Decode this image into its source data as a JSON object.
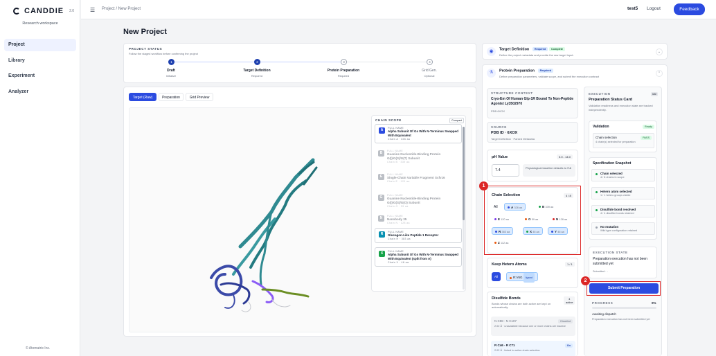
{
  "brand": {
    "name": "CANDDIE",
    "version": "2.0",
    "workspace": "Research workspace",
    "copyright": "© Atomatrix Inc."
  },
  "nav": [
    "Project",
    "Library",
    "Experiment",
    "Analyzer"
  ],
  "topbar": {
    "breadcrumb": "Project / New Project",
    "user": "test5",
    "logout": "Logout",
    "feedback": "Feedback"
  },
  "page_title": "New Project",
  "status": {
    "title": "PROJECT STATUS",
    "subtitle": "Follow the staged workflow before confirming the project",
    "steps": [
      {
        "num": "1",
        "title": "Draft",
        "sub": "Initialize"
      },
      {
        "num": "2",
        "title": "Target Definition",
        "sub": "Required"
      },
      {
        "num": "3",
        "title": "Protein Preparation",
        "sub": "Required"
      },
      {
        "num": "4",
        "title": "Grid Gen.",
        "sub": "Optional"
      }
    ]
  },
  "viewer": {
    "tabs": [
      "Target (Raw)",
      "Preparation",
      "Grid Preview"
    ]
  },
  "chain_scope": {
    "title": "CHAIN SCOPE",
    "compact": "Compact",
    "full_name_label": "FULL NAME",
    "items": [
      {
        "id": "A",
        "name": "Alpha Subunit Of Gs With N-Terminus Swapped With Equivalent",
        "meta": "Chain A · 326 aa",
        "color": "#2b4be0",
        "dim": false
      },
      {
        "id": "B",
        "name": "Guanine Nucleotide-Binding Protein G(I)/G(S)/G(T) Subunit",
        "meta": "Chain B · 339 aa",
        "color": "#6b7280",
        "dim": true
      },
      {
        "id": "E",
        "name": "Single-Chain Variable Fragment Scfv16",
        "meta": "Chain E · 120 aa",
        "color": "#6b7280",
        "dim": true
      },
      {
        "id": "G",
        "name": "Guanine Nucleotide-Binding Protein G(I)/G(S)/G(O) Subunit",
        "meta": "Chain G · 59 aa",
        "color": "#6b7280",
        "dim": true
      },
      {
        "id": "N",
        "name": "Nanobody 35",
        "meta": "Chain N · 128 aa",
        "color": "#6b7280",
        "dim": true
      },
      {
        "id": "R",
        "name": "Glucagon-Like Peptide 1 Receptor",
        "meta": "Chain R · 383 aa",
        "color": "#0891b2",
        "dim": false
      },
      {
        "id": "X",
        "name": "Alpha Subunit Of Gs With N-Terminus Swapped With Equivalent (split from A)",
        "meta": "Chain X · 46 aa",
        "color": "#16a34a",
        "dim": false
      }
    ]
  },
  "target_def": {
    "title": "Target Definition",
    "badge1": "Required",
    "badge2": "Complete",
    "desc": "Define the project metadata and provide the raw target input."
  },
  "protein_prep": {
    "title": "Protein Preparation",
    "badge": "Required",
    "desc": "Define preparation parameters, validate scope, and submit the execution contract"
  },
  "structure": {
    "label": "STRUCTURE CONTEXT",
    "name": "Cryo-Em Of Human Glp-1R Bound To Non-Peptide Agonist Ly3502970",
    "pdb": "PDB 6XOX"
  },
  "source": {
    "label": "SOURCE",
    "pdb": "PDB ID · 6XOX",
    "sub": "Target Definition · Parsed Metadata"
  },
  "ph": {
    "label": "pH Value",
    "range": "0.0 - 14.0",
    "value": "7.4",
    "hint_prefix": "Physiological baseline defaults to ",
    "hint_val": "7.4"
  },
  "chain_sel": {
    "label": "Chain Selection",
    "count": "4 / 8",
    "all": "All",
    "chips": [
      {
        "id": "A",
        "len": "326 aa",
        "color": "#2b4be0",
        "sel": true
      },
      {
        "id": "B",
        "len": "339 aa",
        "color": "#16a34a",
        "sel": false
      },
      {
        "id": "E",
        "len": "120 aa",
        "color": "#7c3aed",
        "sel": false
      },
      {
        "id": "G",
        "len": "59 aa",
        "color": "#ea580c",
        "sel": false
      },
      {
        "id": "N",
        "len": "128 aa",
        "color": "#dc2626",
        "sel": false
      },
      {
        "id": "R",
        "len": "383 aa",
        "color": "#2b4be0",
        "sel": true
      },
      {
        "id": "X",
        "len": "46 aa",
        "color": "#16a34a",
        "sel": true
      },
      {
        "id": "Y",
        "len": "46 aa",
        "color": "#2b4be0",
        "sel": true
      },
      {
        "id": "Z",
        "len": "112 aa",
        "color": "#ea580c",
        "sel": false
      }
    ]
  },
  "hetero": {
    "label": "Keep Hetero Atoms",
    "count": "1 / 1",
    "all": "All",
    "chip": "R:V6G",
    "chip_tag": "ligand"
  },
  "disulfide": {
    "label": "Disulfide Bonds",
    "desc": "Bonds whose chains are both active are kept on automatically.",
    "count": "4",
    "count_sub": "active",
    "bonds": [
      {
        "name": "N C98 - N C107",
        "status": "Disabled",
        "desc": "2.02 Å · unavailable because one or more chains are inactive"
      },
      {
        "name": "R C46 - R C71",
        "status": "On",
        "desc": "2.02 Å · linked to active chain selection"
      }
    ]
  },
  "execution": {
    "label": "EXECUTION",
    "title": "Preparation Status Card",
    "desc": "Validation readiness and execution state are tracked independently.",
    "idle": "Idle",
    "validation": "Validation",
    "ready": "Ready",
    "chain_sel": "Chain selection",
    "pass": "PASS",
    "chain_sub": "4 chain(s) selected for preparation"
  },
  "snapshot": {
    "title": "Specification Snapshot",
    "items": [
      {
        "t": "Chain selected",
        "s": "4 / 8 chains in scope",
        "color": "#16a34a"
      },
      {
        "t": "Hetero atom selected",
        "s": "1 / 1 hetero groups visible",
        "color": "#16a34a"
      },
      {
        "t": "Disulfide bond resolved",
        "s": "4 / 4 disulfide bonds retained",
        "color": "#16a34a"
      },
      {
        "t": "No mutation",
        "s": "Wild type configuration retained",
        "color": "#9ca3af"
      }
    ]
  },
  "exec_state": {
    "label": "EXECUTION STATE",
    "text": "Preparation execution has not been submitted yet",
    "sub": "Submitted · -"
  },
  "submit": "Submit Preparation",
  "progress": {
    "label": "PROGRESS",
    "pct": "0%",
    "value": 0,
    "state": "Awaiting dispatch",
    "desc": "Preparation execution has not been submitted yet"
  },
  "annotations": [
    "1",
    "2"
  ]
}
